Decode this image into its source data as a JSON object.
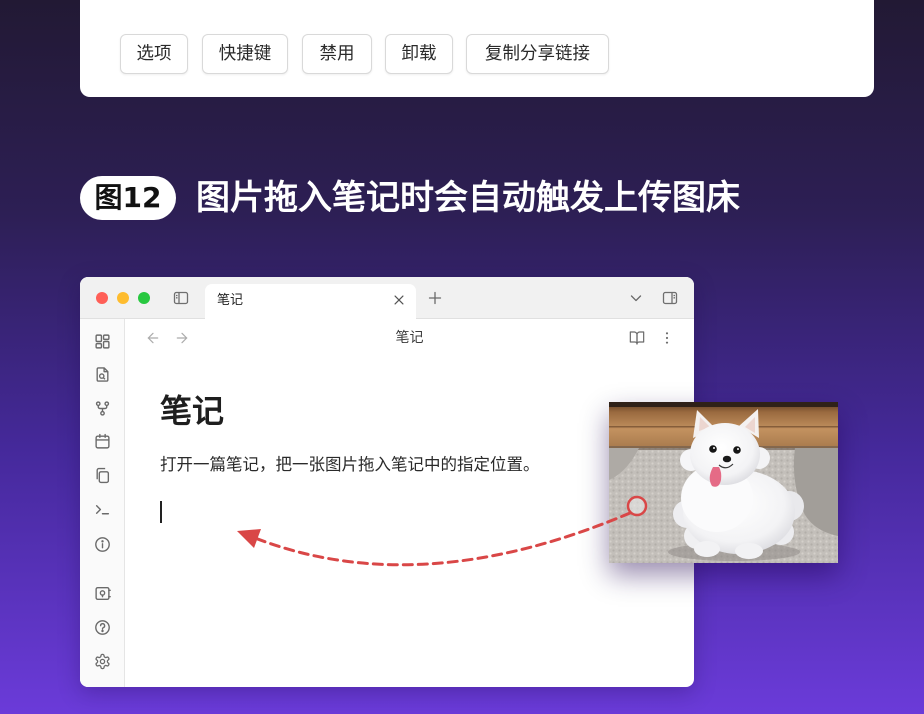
{
  "colors": {
    "background_top": "#221934",
    "background_mid": "#45299b",
    "background_bottom": "#6b3bd9",
    "arrow_red": "#d94747",
    "light_close": "#ff5f57",
    "light_minimize": "#febc2e",
    "light_zoom": "#28c840"
  },
  "top_card": {
    "buttons": [
      {
        "label": "选项"
      },
      {
        "label": "快捷键"
      },
      {
        "label": "禁用"
      },
      {
        "label": "卸载"
      },
      {
        "label": "复制分享链接"
      }
    ]
  },
  "section_heading": {
    "badge": "图12",
    "title": "图片拖入笔记时会自动触发上传图床"
  },
  "app": {
    "titlebar": {
      "sidebar_toggle_icon": "sidebar-left-icon",
      "tab": {
        "label": "笔记",
        "close_icon": "close-icon"
      },
      "new_tab_icon": "plus-icon",
      "tab_list_icon": "chevron-down-icon",
      "right_sidebar_icon": "sidebar-right-icon"
    },
    "ribbon": {
      "icons": [
        "grid-icon",
        "file-search-icon",
        "git-fork-icon",
        "calendar-icon",
        "copy-icon",
        "terminal-icon",
        "info-icon",
        "vault-icon",
        "help-icon",
        "settings-icon"
      ]
    },
    "nav": {
      "back_icon": "arrow-left-icon",
      "forward_icon": "arrow-right-icon",
      "title": "笔记",
      "reading_view_icon": "book-open-icon",
      "more_icon": "more-vertical-icon"
    },
    "note": {
      "heading": "笔记",
      "paragraph": "打开一篇笔记，把一张图片拖入笔记中的指定位置。"
    }
  }
}
